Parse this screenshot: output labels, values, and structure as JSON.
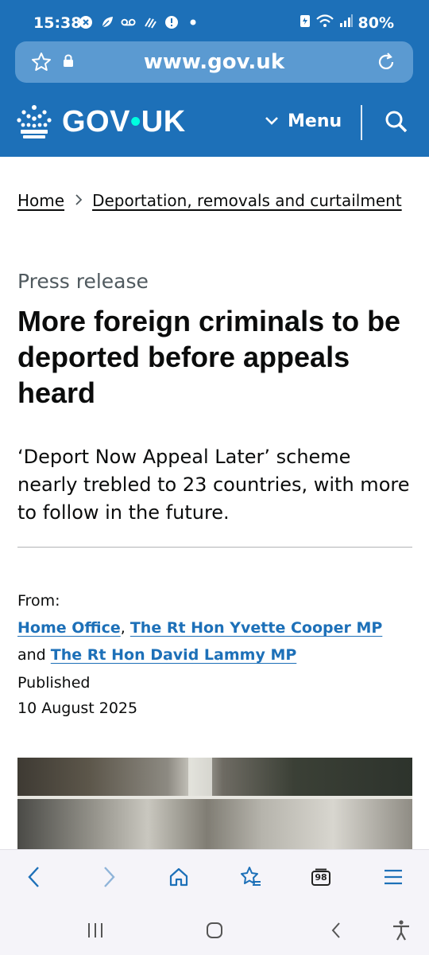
{
  "status": {
    "time": "15:38",
    "battery": "80%",
    "icons_left": [
      "x-circle-icon",
      "leaf-icon",
      "voicemail-icon",
      "nfc-icon",
      "alert-icon",
      "dot-icon"
    ],
    "icons_right": [
      "battery-saver-icon",
      "wifi-icon",
      "signal-icon"
    ]
  },
  "browser": {
    "url": "www.gov.uk"
  },
  "header": {
    "logo_left": "GOV",
    "logo_dot": "•",
    "logo_right": "UK",
    "menu_label": "Menu"
  },
  "breadcrumb": {
    "items": [
      "Home",
      "Deportation, removals and curtailment"
    ]
  },
  "article": {
    "caption": "Press release",
    "title": "More foreign criminals to be deported before appeals heard",
    "lede": "‘Deport Now Appeal Later’ scheme nearly trebled to 23 countries, with more to follow in the future.",
    "from_label": "From:",
    "from_orgs": [
      "Home Office",
      "The Rt Hon Yvette Cooper MP",
      "The Rt Hon David Lammy MP"
    ],
    "from_sep1": ", ",
    "from_sep2": "and ",
    "published_label": "Published",
    "published_date": "10 August 2025"
  },
  "bottom_bar": {
    "tab_count": "98"
  },
  "colors": {
    "brand_blue": "#1d70b8",
    "link_blue": "#1d70b8",
    "text": "#0b0c0c",
    "secondary_text": "#505a5f",
    "logo_dot": "#00ffe0"
  }
}
